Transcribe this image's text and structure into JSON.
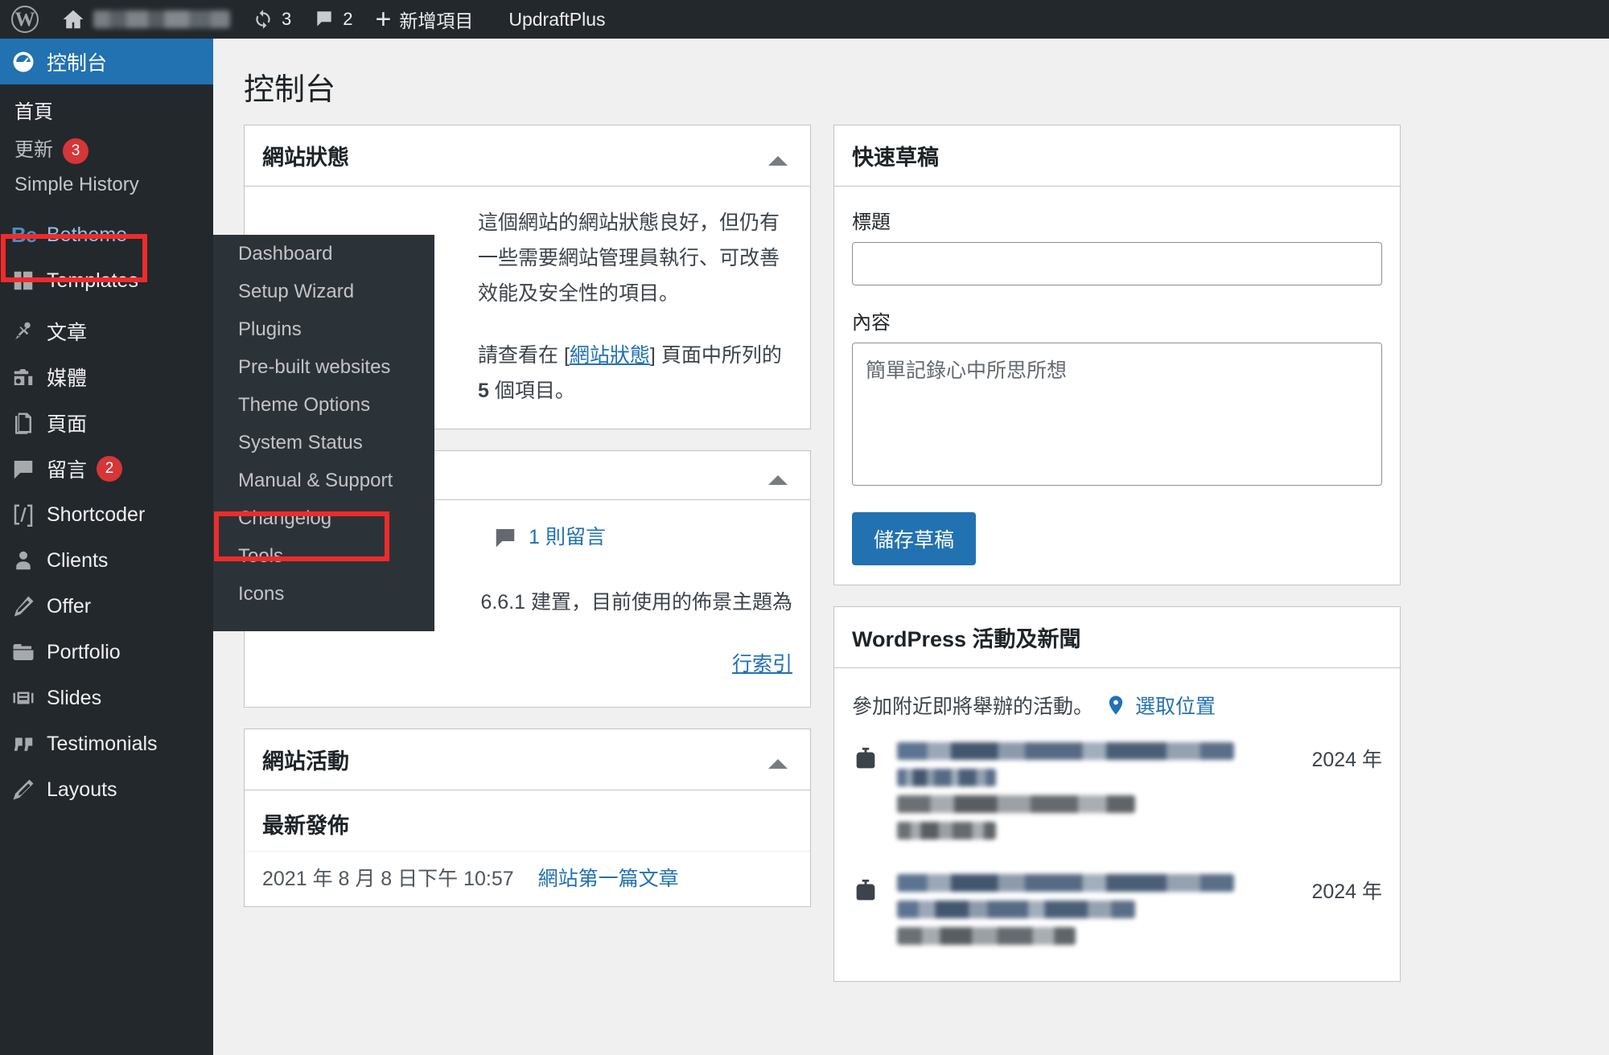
{
  "adminbar": {
    "wp_logo_icon": "wordpress-logo-icon",
    "home_icon": "home-icon",
    "site_name_blurred": "",
    "updates_icon": "updates-sync-icon",
    "updates_count": "3",
    "comments_icon": "comment-bubble-icon",
    "comments_count": "2",
    "new_icon": "plus-icon",
    "new_label": "新增項目",
    "updraft_label": "UpdraftPlus"
  },
  "sidebar": {
    "current_item": "控制台",
    "items": [
      {
        "label": "控制台",
        "icon": "dashboard-gauge-icon",
        "current": true
      },
      {
        "label": "Betheme",
        "icon": "be-logo-icon",
        "highlighted": true
      },
      {
        "label": "Templates",
        "icon": "templates-grid-icon"
      },
      {
        "label": "文章",
        "icon": "pin-icon"
      },
      {
        "label": "媒體",
        "icon": "media-camera-icon"
      },
      {
        "label": "頁面",
        "icon": "page-icon"
      },
      {
        "label": "留言",
        "icon": "comment-icon",
        "badge": "2"
      },
      {
        "label": "Shortcoder",
        "icon": "code-brackets-icon"
      },
      {
        "label": "Clients",
        "icon": "user-icon"
      },
      {
        "label": "Offer",
        "icon": "offer-document-icon"
      },
      {
        "label": "Portfolio",
        "icon": "folder-icon"
      },
      {
        "label": "Slides",
        "icon": "slides-icon"
      },
      {
        "label": "Testimonials",
        "icon": "quote-icon"
      },
      {
        "label": "Layouts",
        "icon": "pencil-icon"
      }
    ],
    "dashboard_submenu": [
      {
        "label": "首頁"
      },
      {
        "label": "更新",
        "badge": "3"
      },
      {
        "label": "Simple History"
      }
    ]
  },
  "flyout": {
    "parent": "Betheme",
    "highlighted_item": "Theme Options",
    "items": [
      {
        "label": "Dashboard"
      },
      {
        "label": "Setup Wizard"
      },
      {
        "label": "Plugins"
      },
      {
        "label": "Pre-built websites"
      },
      {
        "label": "Theme Options",
        "highlighted": true
      },
      {
        "label": "System Status"
      },
      {
        "label": "Manual & Support"
      },
      {
        "label": "Changelog"
      },
      {
        "label": "Tools"
      },
      {
        "label": "Icons"
      }
    ]
  },
  "main": {
    "page_title": "控制台",
    "site_health": {
      "title": "網站狀態",
      "toggle_icon": "chevron-up-icon",
      "gauge_color": "#00a32a",
      "paragraph": "這個網站的網站狀態良好，但仍有一些需要網站管理員執行、可改善效能及安全性的項目。",
      "notice_prefix": "請查看在 [",
      "notice_link": "網站狀態",
      "notice_middle": "] 頁面中所列的 ",
      "notice_count": "5",
      "notice_suffix": " 個項目。"
    },
    "at_a_glance": {
      "toggle_icon": "chevron-up-icon",
      "comment_icon": "comment-bubble-icon",
      "comments_link": "1 則留言",
      "version_text": "6.6.1 建置，目前使用的佈景主題為",
      "search_engine_link": "行索引"
    },
    "activity": {
      "title": "網站活動",
      "toggle_icon": "chevron-up-icon",
      "subheading": "最新發佈",
      "rows": [
        {
          "date": "2021 年 8 月 8 日下午 10:57",
          "link": "網站第一篇文章"
        }
      ]
    }
  },
  "right": {
    "quick_draft": {
      "title": "快速草稿",
      "title_label": "標題",
      "title_value": "",
      "content_label": "內容",
      "content_placeholder": "簡單記錄心中所思所想",
      "content_value": "",
      "save_label": "儲存草稿",
      "save_color": "#2271b1"
    },
    "news": {
      "title": "WordPress 活動及新聞",
      "intro": "參加附近即將舉辦的活動。",
      "location_icon": "location-pin-icon",
      "location_link": "選取位置",
      "events": [
        {
          "icon": "meetup-icon",
          "date": "2024 年"
        },
        {
          "icon": "meetup-icon",
          "date": "2024 年"
        }
      ]
    }
  }
}
